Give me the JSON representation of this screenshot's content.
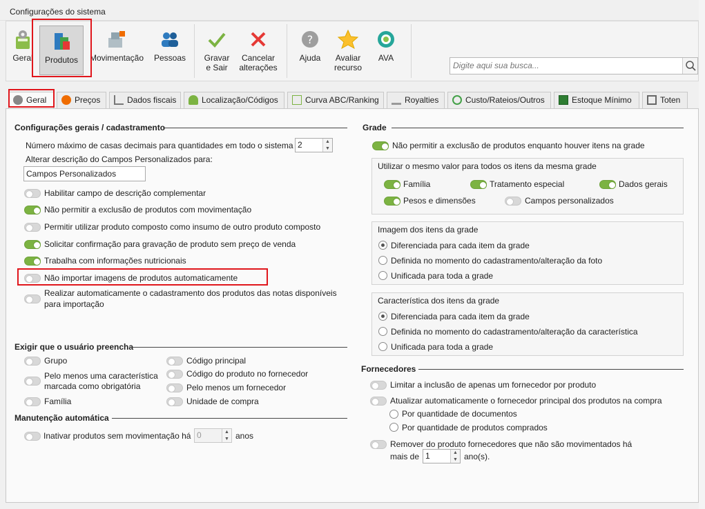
{
  "window": {
    "title": "Configurações do sistema"
  },
  "toolbar": {
    "geral": "Geral",
    "produtos": "Produtos",
    "movimentacao": "Movimentação",
    "pessoas": "Pessoas",
    "gravar_l1": "Gravar",
    "gravar_l2": "e Sair",
    "cancelar_l1": "Cancelar",
    "cancelar_l2": "alterações",
    "ajuda": "Ajuda",
    "avaliar_l1": "Avaliar",
    "avaliar_l2": "recurso",
    "ava": "AVA"
  },
  "search": {
    "placeholder": "Digite aqui sua busca..."
  },
  "tabs": [
    "Geral",
    "Preços",
    "Dados fiscais",
    "Localização/Códigos",
    "Curva ABC/Ranking",
    "Royalties",
    "Custo/Rateios/Outros",
    "Estoque Mínimo",
    "Toten"
  ],
  "left": {
    "general_title": "Configurações gerais / cadastramento",
    "decimals_label": "Número máximo de casas decimais para quantidades em todo o sistema",
    "decimals_value": "2",
    "custom_fields_label": "Alterar descrição do Campos Personalizados para:",
    "custom_fields_value": "Campos Personalizados",
    "toggles": [
      {
        "label": "Habilitar campo de descrição complementar",
        "on": false
      },
      {
        "label": "Não permitir a exclusão de produtos com movimentação",
        "on": true
      },
      {
        "label": "Permitir utilizar produto composto como insumo de outro produto composto",
        "on": false
      },
      {
        "label": "Solicitar confirmação para gravação de produto sem preço de venda",
        "on": true
      },
      {
        "label": "Trabalha com informações nutricionais",
        "on": true
      },
      {
        "label": "Não importar imagens de produtos automaticamente",
        "on": false
      },
      {
        "label_l1": "Realizar automaticamente o cadastramento dos produtos das notas disponíveis",
        "label_l2": "para importação",
        "on": false
      }
    ],
    "required_title": "Exigir que o usuário preencha",
    "required": {
      "grupo": "Grupo",
      "caracteristica_l1": "Pelo menos uma característica",
      "caracteristica_l2": "marcada como obrigatória",
      "familia": "Família",
      "codigo_principal": "Código principal",
      "codigo_fornecedor": "Código do produto no fornecedor",
      "um_fornecedor": "Pelo menos um fornecedor",
      "unidade_compra": "Unidade de compra"
    },
    "maintenance_title": "Manutenção automática",
    "inactivate_label": "Inativar produtos sem movimentação há",
    "inactivate_value": "0",
    "inactivate_unit": "anos"
  },
  "right": {
    "grade_title": "Grade",
    "grade_no_delete": "Não permitir a exclusão de produtos enquanto houver itens na grade",
    "same_value_title": "Utilizar o mesmo valor para todos os itens da mesma grade",
    "same_value": {
      "familia": "Família",
      "tratamento": "Tratamento especial",
      "dados_gerais": "Dados gerais",
      "pesos": "Pesos e dimensões",
      "campos": "Campos personalizados"
    },
    "image_title": "Imagem dos itens da grade",
    "image_options": [
      "Diferenciada para cada item da grade",
      "Definida no momento do cadastramento/alteração da foto",
      "Unificada para toda a grade"
    ],
    "char_title": "Característica dos itens da grade",
    "char_options": [
      "Diferenciada para cada item da grade",
      "Definida no momento do cadastramento/alteração da característica",
      "Unificada para toda a grade"
    ],
    "suppliers_title": "Fornecedores",
    "limit_supplier": "Limitar a inclusão de apenas um fornecedor por produto",
    "update_supplier": "Atualizar automaticamente o fornecedor principal dos produtos na compra",
    "by_docs": "Por quantidade de documentos",
    "by_qty": "Por quantidade de produtos comprados",
    "remove_l1": "Remover do produto fornecedores que não são movimentados há",
    "remove_l2": "mais de",
    "remove_value": "1",
    "remove_unit": "ano(s)."
  },
  "colors": {
    "toggle_on": "#7cb342",
    "highlight": "#e0151b"
  }
}
